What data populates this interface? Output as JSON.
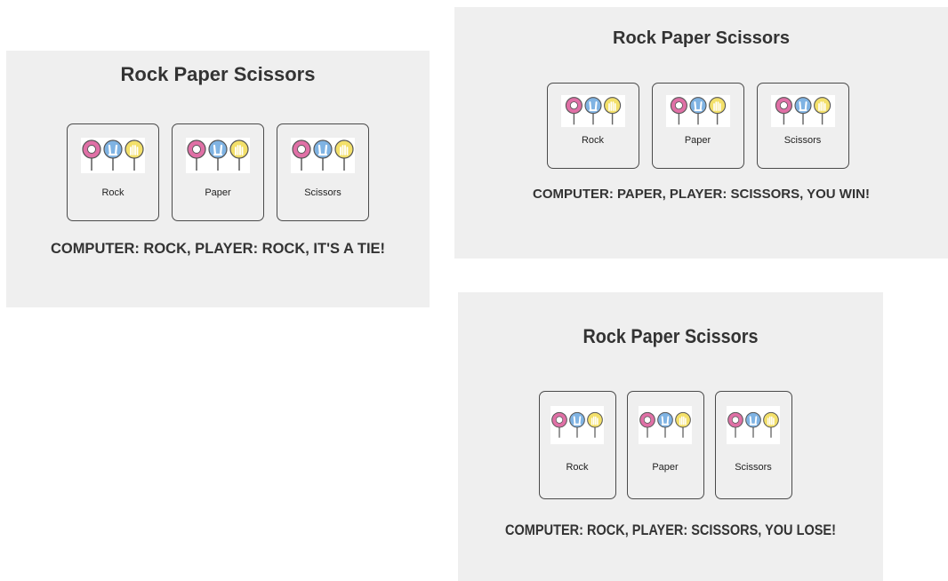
{
  "app_title": "Rock Paper Scissors",
  "choices": [
    "Rock",
    "Paper",
    "Scissors"
  ],
  "icon_colors": {
    "rock": "#e070a6",
    "paper": "#7fb3e3",
    "scissors": "#f3e06a"
  },
  "panels": [
    {
      "title": "Rock Paper Scissors",
      "result": "COMPUTER: ROCK, PLAYER: ROCK, IT'S A TIE!"
    },
    {
      "title": "Rock Paper Scissors",
      "result": "COMPUTER: PAPER, PLAYER: SCISSORS, YOU WIN!"
    },
    {
      "title": "Rock Paper Scissors",
      "result": "COMPUTER: ROCK, PLAYER: SCISSORS, YOU LOSE!"
    }
  ]
}
